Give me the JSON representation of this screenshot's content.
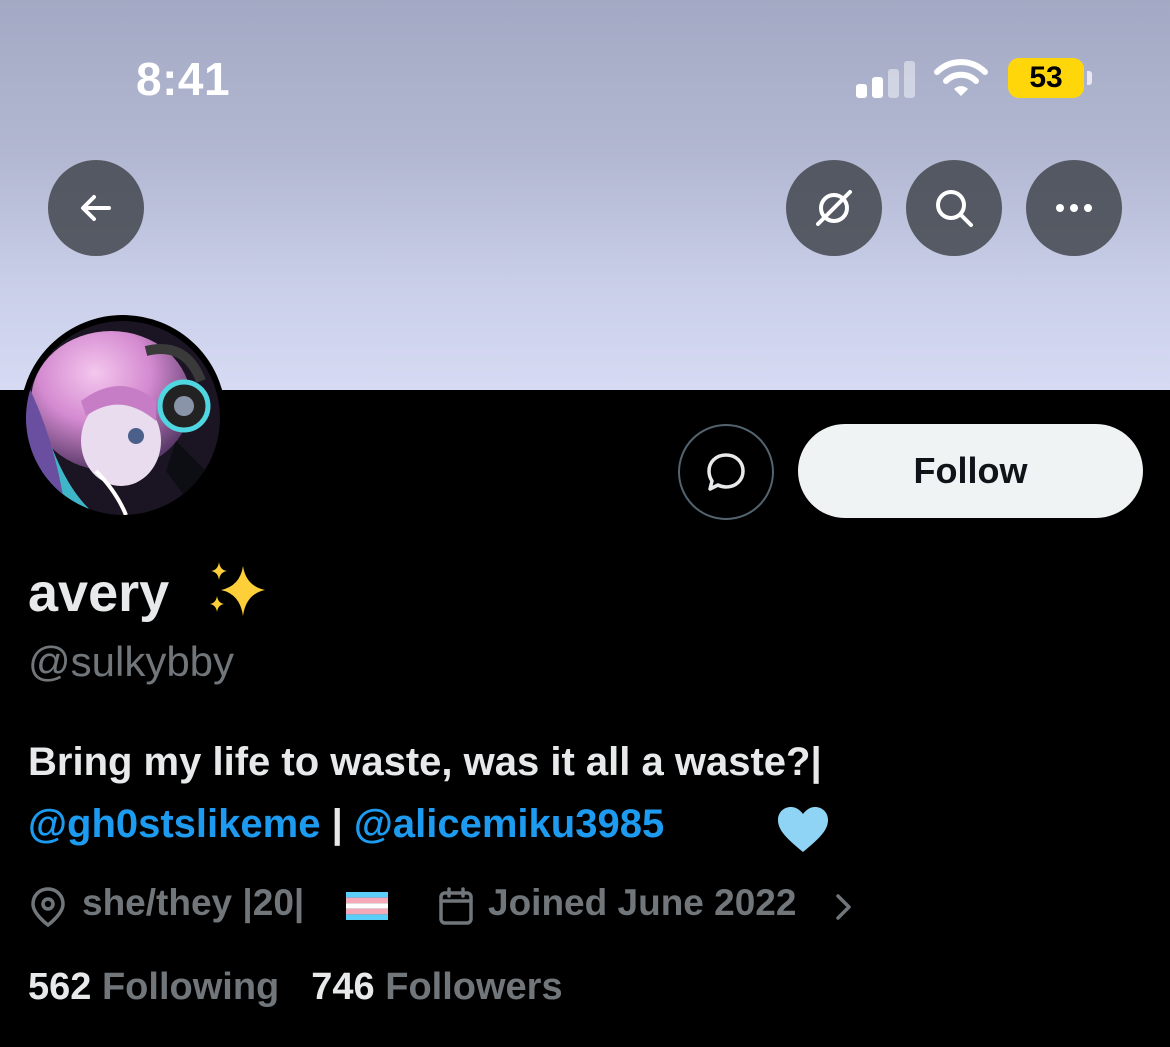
{
  "status_bar": {
    "time": "8:41",
    "battery": "53",
    "icons": [
      "cellular-signal-icon",
      "wifi-icon",
      "battery-icon"
    ]
  },
  "top_nav": {
    "icons": [
      "back-arrow-icon",
      "translate-off-icon",
      "search-icon",
      "more-icon"
    ]
  },
  "profile": {
    "display_name": "avery",
    "name_emoji": "✨",
    "handle": "@sulkybby",
    "follow_label": "Follow",
    "bio_line1": "Bring my life to waste, was it all a waste?|",
    "bio_mention1": "@gh0stslikeme",
    "bio_separator": " | ",
    "bio_mention2": "@alicemiku3985",
    "bio_emoji": "🩵",
    "location": "she/they |20|",
    "location_flag": "transgender-flag",
    "joined": "Joined June 2022",
    "following_count": "562",
    "following_label": "Following",
    "followers_count": "746",
    "followers_label": "Followers"
  },
  "colors": {
    "background": "#000000",
    "banner_top": "#a3a9c4",
    "banner_bottom": "#d6daf3",
    "accent_link": "#1d9bf0",
    "muted_text": "#71767b",
    "primary_text": "#e7e9ea",
    "battery_fill": "#ffd60a",
    "follow_button_bg": "#eff3f4"
  }
}
